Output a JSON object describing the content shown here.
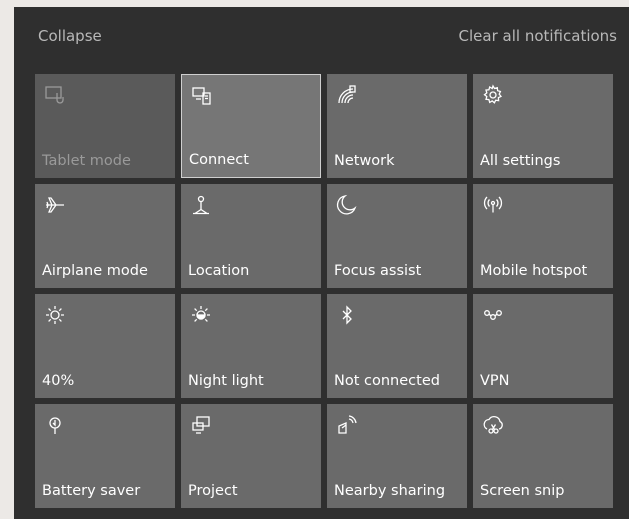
{
  "header": {
    "collapse_label": "Collapse",
    "clear_label": "Clear all notifications"
  },
  "tiles": [
    {
      "label": "Tablet mode",
      "icon": "tablet-mode-icon",
      "state": "disabled"
    },
    {
      "label": "Connect",
      "icon": "connect-icon",
      "state": "selected"
    },
    {
      "label": "Network",
      "icon": "network-icon",
      "state": "normal"
    },
    {
      "label": "All settings",
      "icon": "settings-gear-icon",
      "state": "normal"
    },
    {
      "label": "Airplane mode",
      "icon": "airplane-icon",
      "state": "normal"
    },
    {
      "label": "Location",
      "icon": "location-icon",
      "state": "normal"
    },
    {
      "label": "Focus assist",
      "icon": "moon-icon",
      "state": "normal"
    },
    {
      "label": "Mobile hotspot",
      "icon": "hotspot-icon",
      "state": "normal"
    },
    {
      "label": "40%",
      "icon": "brightness-icon",
      "state": "normal"
    },
    {
      "label": "Night light",
      "icon": "night-light-icon",
      "state": "normal"
    },
    {
      "label": "Not connected",
      "icon": "bluetooth-icon",
      "state": "normal"
    },
    {
      "label": "VPN",
      "icon": "vpn-icon",
      "state": "normal"
    },
    {
      "label": "Battery saver",
      "icon": "battery-saver-icon",
      "state": "normal"
    },
    {
      "label": "Project",
      "icon": "project-icon",
      "state": "normal"
    },
    {
      "label": "Nearby sharing",
      "icon": "nearby-sharing-icon",
      "state": "normal"
    },
    {
      "label": "Screen snip",
      "icon": "screen-snip-icon",
      "state": "normal"
    }
  ],
  "colors": {
    "panel_bg": "#2f2f2f",
    "tile_bg": "#6a6a6a",
    "tile_disabled_bg": "#5a5a5a",
    "text": "#ffffff",
    "muted_text": "#b8b8b8"
  }
}
